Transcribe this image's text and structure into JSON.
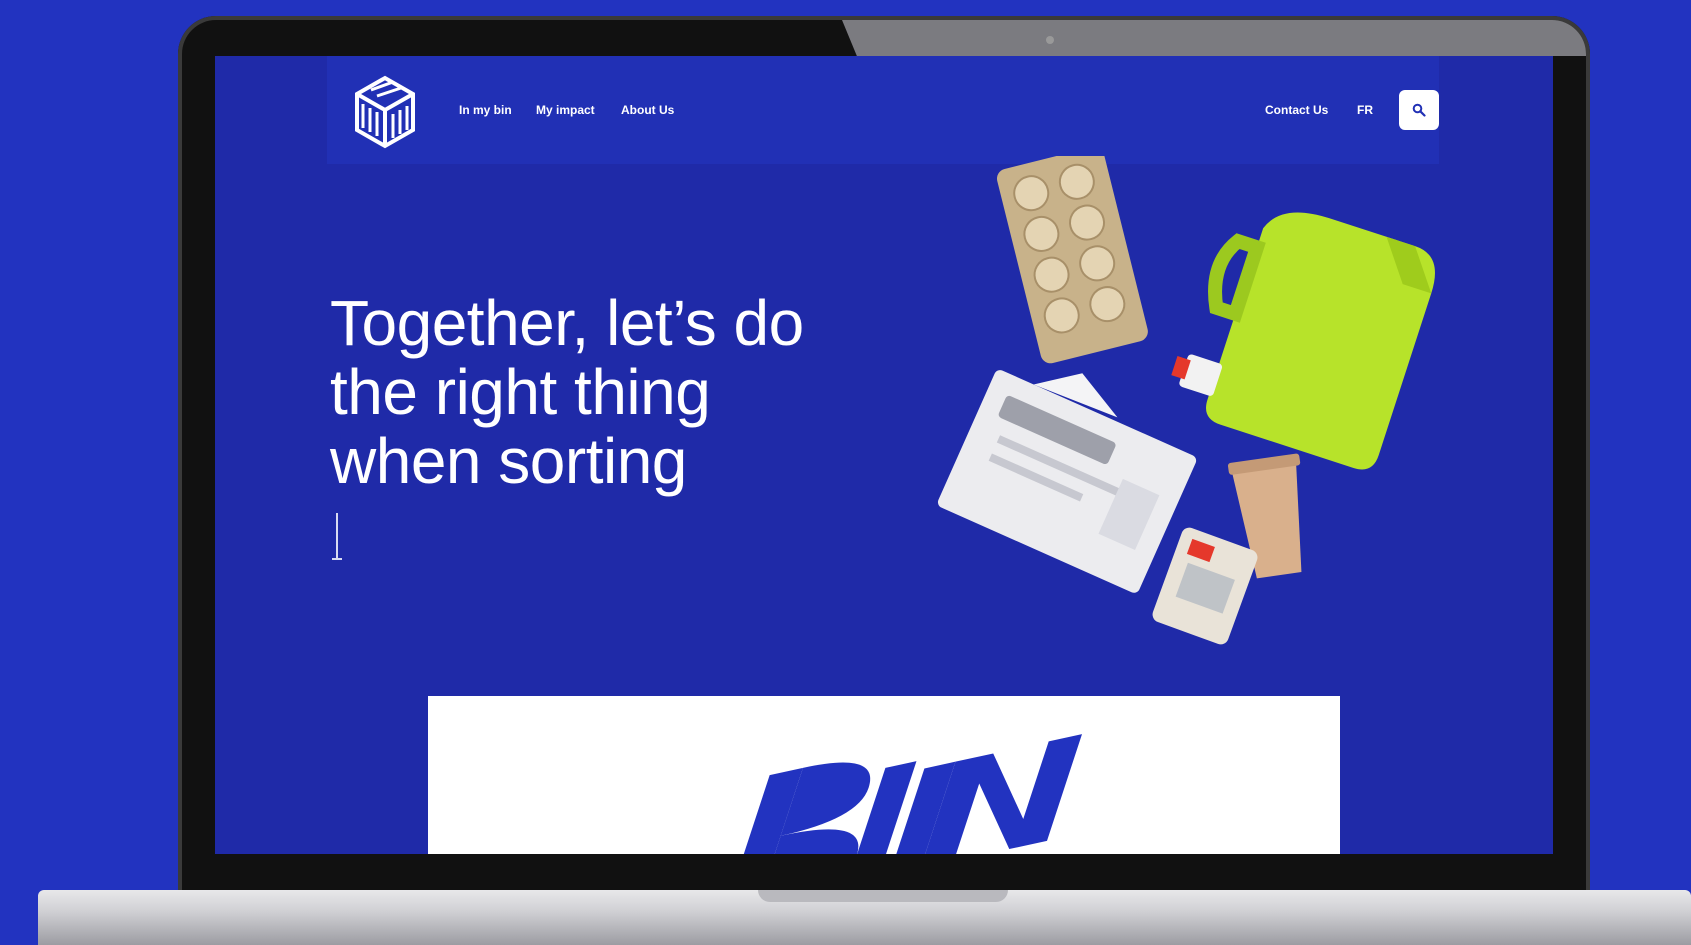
{
  "nav": {
    "links": [
      "In my bin",
      "My impact",
      "About Us"
    ],
    "contact_label": "Contact Us",
    "language_label": "FR"
  },
  "hero": {
    "title_lines": [
      "Together, let’s do",
      "the right thing",
      "when sorting"
    ]
  },
  "colors": {
    "background": "#2233c0",
    "screen": "#1f2aa8",
    "accent_green": "#b7e32a",
    "white": "#ffffff"
  },
  "icons": {
    "search": "search-icon",
    "logo": "bin-impact-logo",
    "scroll": "arrow-down-icon"
  }
}
